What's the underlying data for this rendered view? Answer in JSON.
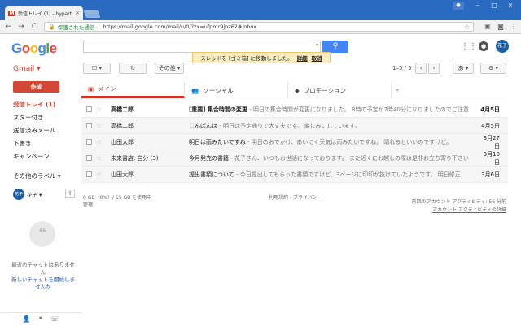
{
  "browser": {
    "tab_title": "受信トレイ (1) - hypartpm",
    "tab_favicon": "M",
    "tab_close": "×",
    "profile_icon": "person-icon",
    "secure_label": "保護された通信",
    "url": "https://mail.google.com/mail/u/0/?zx=ufpmr9joz62#inbox",
    "minimize": "–",
    "maximize": "□",
    "close": "×",
    "back": "←",
    "forward": "→",
    "reload": "C"
  },
  "header": {
    "search_placeholder": "",
    "apps_icon": "apps-grid-icon",
    "notifications_icon": "notifications-icon",
    "avatar_label": "花子"
  },
  "toast": {
    "message": "スレッドを [ゴミ箱] に移動しました。",
    "detail": "詳細",
    "undo": "取消"
  },
  "toolbar": {
    "gmail_label": "Gmail ▾",
    "select_label": "☐ ▾",
    "refresh_label": "↻",
    "more_label": "その他 ▾",
    "pager": "1–5 / 5",
    "prev": "‹",
    "next": "›",
    "input_tools": "あ ▾",
    "settings": "⚙ ▾"
  },
  "sidebar": {
    "compose_label": "作成",
    "items": [
      {
        "label": "受信トレイ (1)"
      },
      {
        "label": "スター付き"
      },
      {
        "label": "送信済みメール"
      },
      {
        "label": "下書き"
      },
      {
        "label": "キャンペーン"
      }
    ],
    "more_labels": "その他のラベル ▾",
    "hangouts_user": "花子 ▾",
    "hangouts_add": "+",
    "chat_empty": "最近のチャットはありません",
    "chat_start": "新しいチャットを開始しませんか"
  },
  "tabs": [
    {
      "label": "メイン",
      "icon": "inbox-icon"
    },
    {
      "label": "ソーシャル",
      "icon": "people-icon"
    },
    {
      "label": "プロモーション",
      "icon": "tag-icon"
    }
  ],
  "tab_add": "+",
  "messages": [
    {
      "sender": "高橋二郎",
      "subject": "[重要] 集合時間の変更",
      "snippet": " - 明日の集合時間が変更になりました。 8時の予定が7時40分になりましたのでご注意",
      "date": "4月5日",
      "unread": true
    },
    {
      "sender": "高橋二郎",
      "subject": "こんばんは",
      "snippet": " - 明日は予定通りで大丈夫です。 楽しみにしています。",
      "date": "4月5日",
      "unread": false
    },
    {
      "sender": "山田太郎",
      "subject": "明日は雨みたいですね",
      "snippet": " - 明日のおでかけ、あいにく天気は雨みたいですね。 晴れるといいのですけど。",
      "date": "3月27日",
      "unread": false
    },
    {
      "sender": "未来書店, 自分 (3)",
      "subject": "今月発売の書籍",
      "snippet": " - 花子さん、いつもお世話になっております。 また近くにお越しの際は是非お立ち寄り下さい",
      "date": "3月10日",
      "unread": false
    },
    {
      "sender": "山田太郎",
      "subject": "提出書類について",
      "snippet": " - 今日提出してもらった書類ですけど、3ページに印印が抜けていたようです。 明日修正",
      "date": "3月6日",
      "unread": false
    }
  ],
  "footer": {
    "storage": "0 GB（0%）/ 15 GB を使用中",
    "manage": "管理",
    "terms": "利用規約 - プライバシー",
    "last_activity": "前回のアカウント アクティビティ: 56 分前",
    "activity_details": "アカウント アクティビティの詳細"
  },
  "colors": {
    "chrome_blue": "#2a6ac0",
    "gmail_red": "#d93025",
    "search_blue": "#4285f4",
    "toast_bg": "#f9edbe"
  }
}
